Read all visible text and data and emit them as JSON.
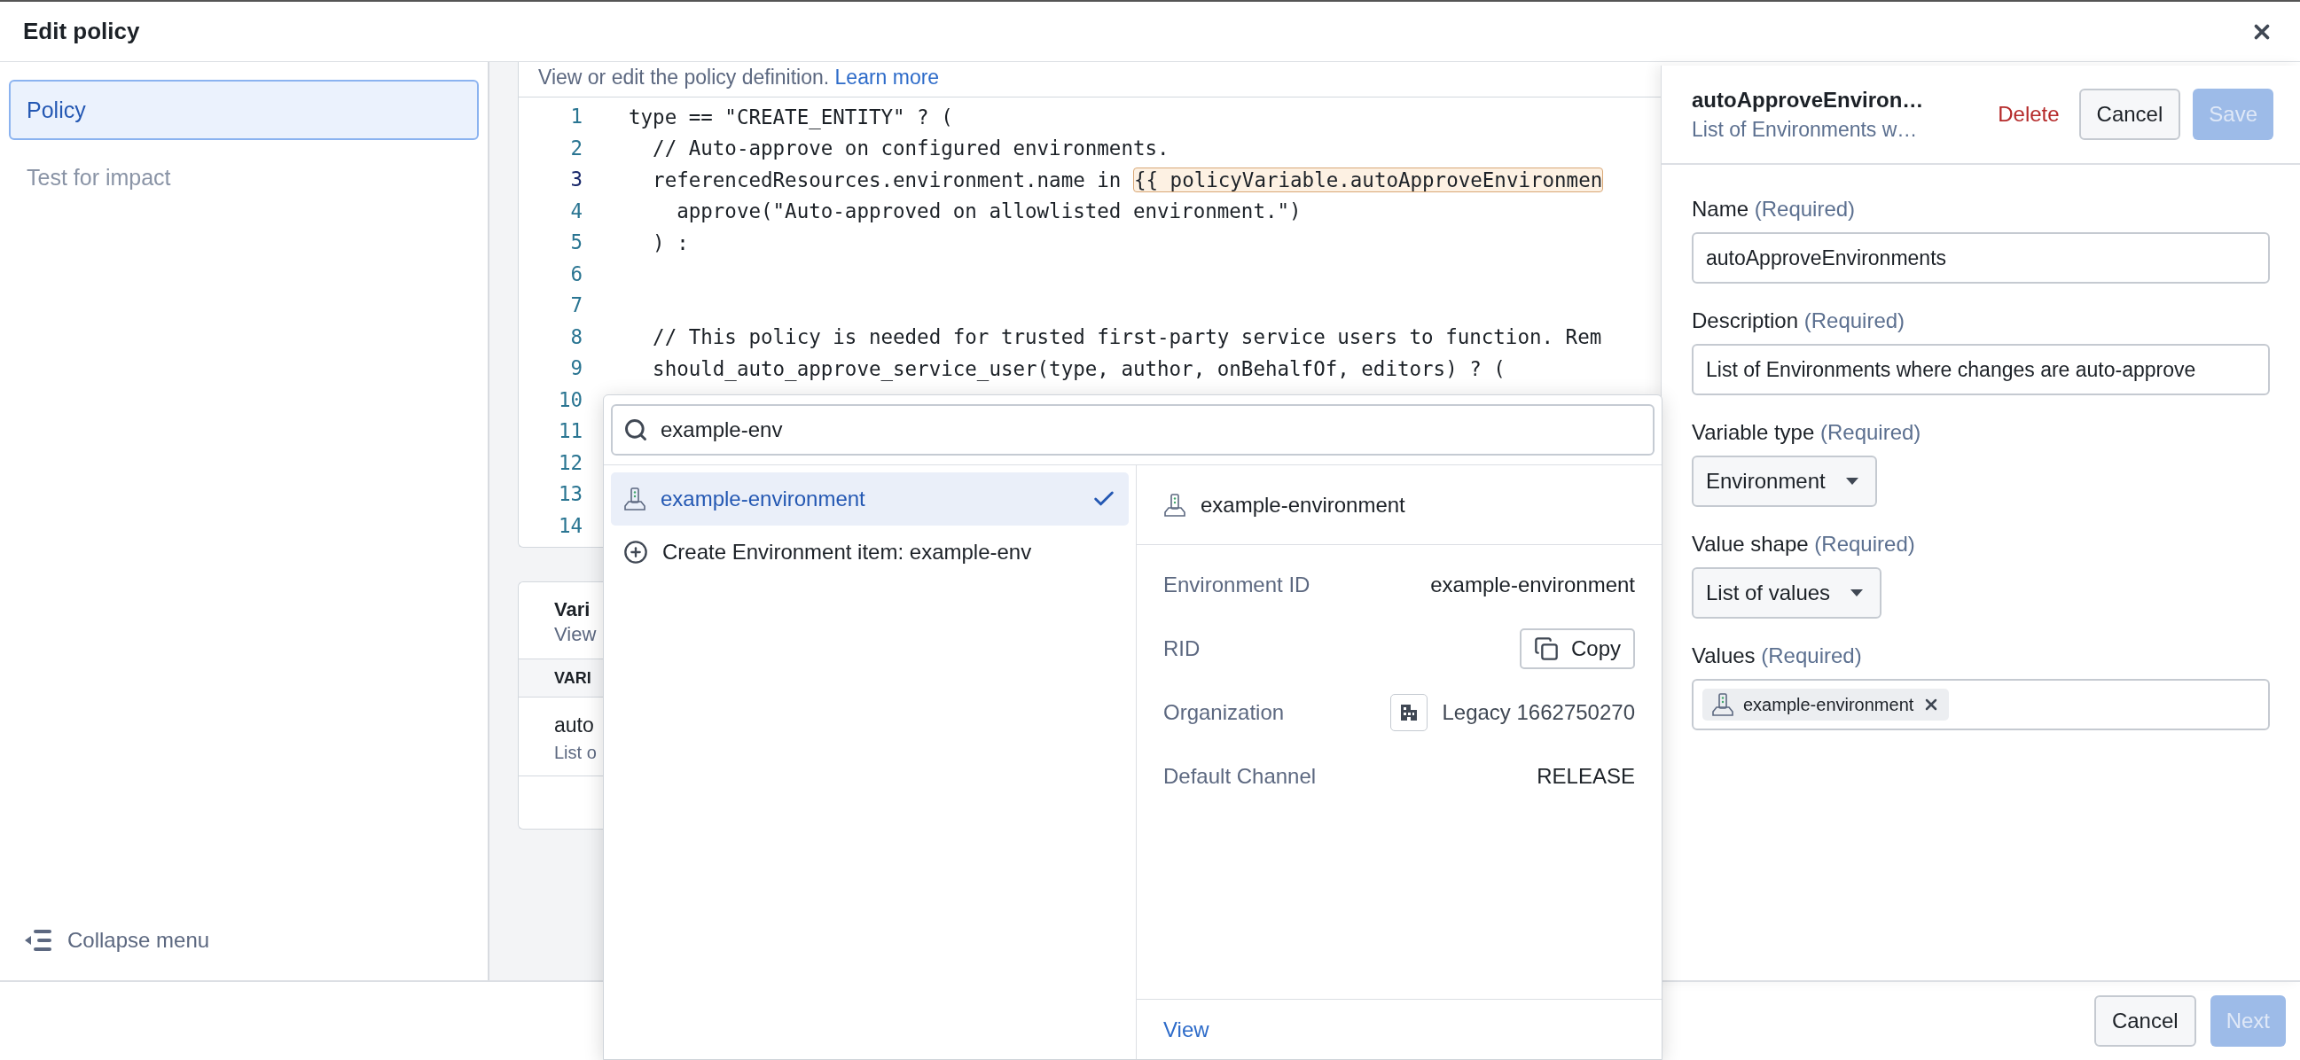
{
  "window": {
    "title": "Edit policy"
  },
  "sidebar": {
    "items": [
      {
        "label": "Policy",
        "selected": true
      },
      {
        "label": "Test for impact",
        "selected": false
      }
    ],
    "collapse_label": "Collapse menu"
  },
  "editor": {
    "hint": "View or edit the policy definition.",
    "link": "Learn more",
    "lines": [
      {
        "number": "1",
        "code": "type == \"CREATE_ENTITY\" ? (",
        "current": false
      },
      {
        "number": "2",
        "code": "  // Auto-approve on configured environments.",
        "current": false
      },
      {
        "number": "3",
        "code": "  referencedResources.environment.name in ",
        "variable": "{{ policyVariable.autoApproveEnvironmen",
        "current": true
      },
      {
        "number": "4",
        "code": "    approve(\"Auto-approved on allowlisted environment.\")",
        "current": false
      },
      {
        "number": "5",
        "code": "  ) :",
        "current": false
      },
      {
        "number": "6",
        "current": false
      },
      {
        "number": "7",
        "current": false
      },
      {
        "number": "8",
        "code": "  // This policy is needed for trusted first-party service users to function. Rem",
        "current": false
      },
      {
        "number": "9",
        "code": "  should_auto_approve_service_user(type, author, onBehalfOf, editors) ? (",
        "current": false
      },
      {
        "number": "10",
        "current": false
      },
      {
        "number": "11",
        "current": false
      },
      {
        "number": "12",
        "current": false
      },
      {
        "number": "13",
        "current": false
      },
      {
        "number": "14",
        "current": false
      }
    ]
  },
  "variables_card": {
    "title": "Vari",
    "subtitle": "View",
    "column_1": "VARI",
    "rows": [
      {
        "name": "auto",
        "description": "List o"
      }
    ]
  },
  "popover": {
    "search": {
      "value": "example-env"
    },
    "results": [
      {
        "label": "example-environment",
        "kind": "environment",
        "selected": true
      },
      {
        "label": "Create Environment item: example-env",
        "kind": "create",
        "selected": false
      }
    ],
    "detail": {
      "title": "example-environment",
      "rows": [
        {
          "label": "Environment ID",
          "value": "example-environment",
          "kind": "text"
        },
        {
          "label": "RID",
          "value": "Copy",
          "kind": "copy"
        },
        {
          "label": "Organization",
          "value": "Legacy 1662750270",
          "kind": "org"
        },
        {
          "label": "Default Channel",
          "value": "RELEASE",
          "kind": "text"
        }
      ],
      "link": "View"
    }
  },
  "panel": {
    "title": "autoApproveEnviron…",
    "subtitle": "List of Environments w…",
    "actions": [
      {
        "label": "Delete",
        "kind": "danger",
        "disabled": false
      },
      {
        "label": "Cancel",
        "kind": "default",
        "disabled": false
      },
      {
        "label": "Save",
        "kind": "primary",
        "disabled": true
      }
    ],
    "fields": [
      {
        "label": "Name",
        "hint": "(Required)",
        "kind": "text",
        "value": "autoApproveEnvironments"
      },
      {
        "label": "Description",
        "hint": "(Required)",
        "kind": "text",
        "value": "List of Environments where changes are auto-approve"
      },
      {
        "label": "Variable type",
        "hint": "(Required)",
        "kind": "select",
        "value": "Environment"
      },
      {
        "label": "Value shape",
        "hint": "(Required)",
        "kind": "select",
        "value": "List of values"
      },
      {
        "label": "Values",
        "hint": "(Required)",
        "kind": "tags",
        "tags": [
          {
            "label": "example-environment"
          }
        ]
      }
    ]
  },
  "footer": {
    "buttons": [
      {
        "label": "Cancel",
        "kind": "default",
        "disabled": false
      },
      {
        "label": "Next",
        "kind": "primary",
        "disabled": true
      }
    ]
  }
}
